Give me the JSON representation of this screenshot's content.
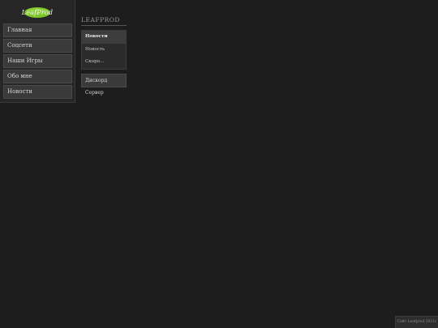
{
  "logo": {
    "text": "LeafProd",
    "leaf_color": "#7dc62a"
  },
  "sidebar": {
    "items": [
      {
        "label": "Главная"
      },
      {
        "label": "Соцсети"
      },
      {
        "label": "Наши Игры"
      },
      {
        "label": "Обо мне"
      },
      {
        "label": "Новости"
      }
    ]
  },
  "section": {
    "title": "LEAFPROD",
    "items": [
      {
        "label": "Новости",
        "active": true
      },
      {
        "label": "Новость"
      },
      {
        "label": "Скоро..."
      }
    ],
    "discord_label": "Дискорд Сервер"
  },
  "footer": {
    "text": "Сайт Leafprod 2021г"
  }
}
